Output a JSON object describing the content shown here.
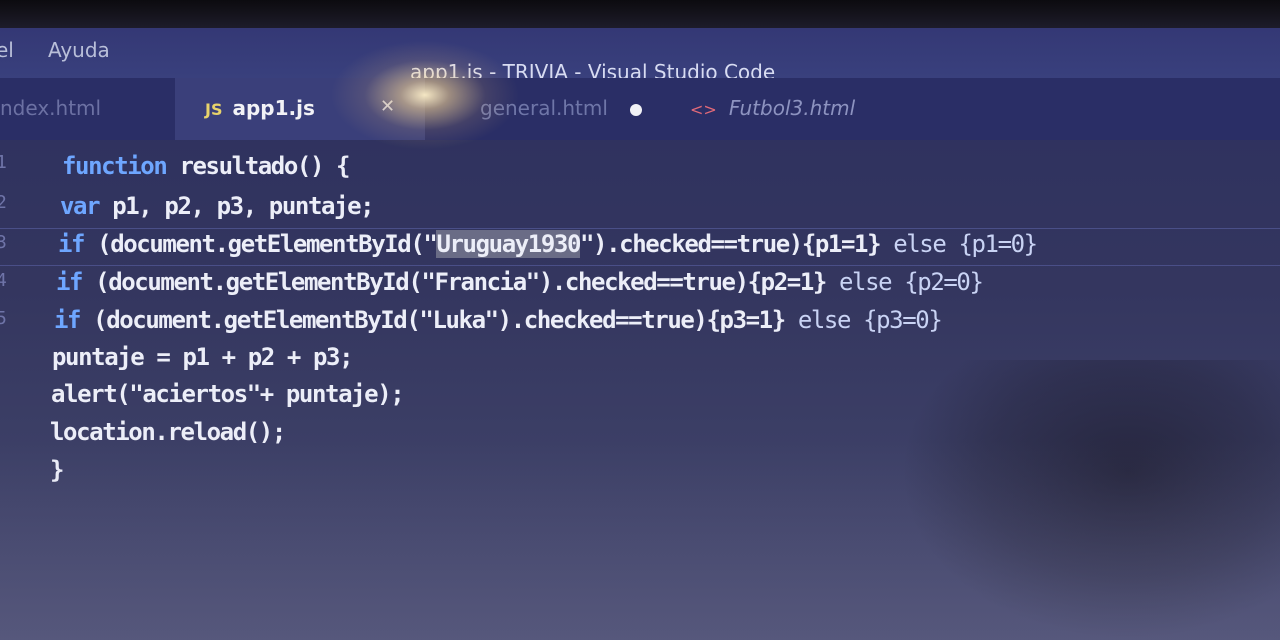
{
  "menubar": {
    "items": [
      {
        "label": "el"
      },
      {
        "label": "Ayuda"
      }
    ],
    "window_title": "app1.js - TRIVIA - Visual Studio Code"
  },
  "tabs": [
    {
      "label": "ndex.html",
      "state": "inactive"
    },
    {
      "label": "app1.js",
      "state": "active",
      "icon": "JS",
      "close_glyph": "✕"
    },
    {
      "label": "general.html",
      "state": "modified"
    },
    {
      "label": "Futbol3.html",
      "state": "preview",
      "icon": "<>"
    }
  ],
  "editor": {
    "gutter": [
      "1",
      "2",
      "3",
      "4",
      "5"
    ],
    "lines": [
      {
        "kw": "function",
        "rest": " resultado() {"
      },
      {
        "kw": "var",
        "rest": " p1, p2, p3, puntaje;"
      },
      {
        "kw": "if",
        "pre": " (document.getElementById(\"",
        "sel": "Uruguay1930",
        "post": "\").checked==true){p1=1} ",
        "else_kw": "else",
        "tail": " {p1=0}"
      },
      {
        "kw": "if",
        "pre": " (document.getElementById(\"Francia\").checked==true){p2=1} ",
        "else_kw": "else",
        "tail": " {p2=0}"
      },
      {
        "kw": "if",
        "pre": " (document.getElementById(\"Luka\").checked==true){p3=1} ",
        "else_kw": "else",
        "tail": " {p3=0}"
      },
      {
        "text": "puntaje = p1 + p2 + p3;"
      },
      {
        "text": "alert(\"aciertos\"+ puntaje);"
      },
      {
        "text": "location.reload();"
      },
      {
        "text": "}"
      }
    ]
  },
  "colors": {
    "keyword": "#6ea6ff",
    "text": "#eceef8",
    "js_badge": "#e8d36b",
    "html_glyph": "#e26a78"
  }
}
